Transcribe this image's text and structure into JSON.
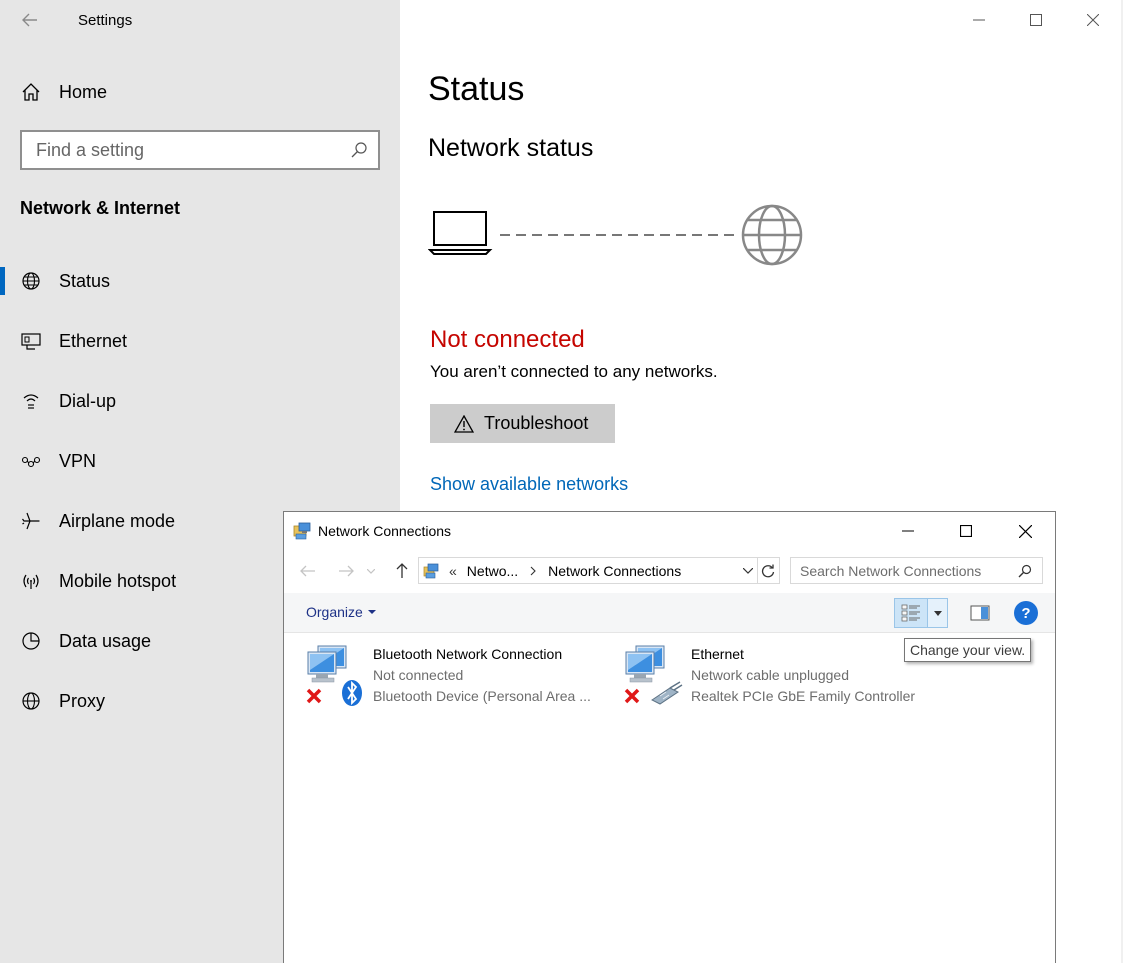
{
  "settings": {
    "app_title": "Settings",
    "home_label": "Home",
    "search_placeholder": "Find a setting",
    "section_title": "Network & Internet",
    "nav_items": [
      {
        "label": "Status",
        "icon": "status-globe-icon"
      },
      {
        "label": "Ethernet",
        "icon": "ethernet-icon"
      },
      {
        "label": "Dial-up",
        "icon": "dial-up-icon"
      },
      {
        "label": "VPN",
        "icon": "vpn-icon"
      },
      {
        "label": "Airplane mode",
        "icon": "airplane-icon"
      },
      {
        "label": "Mobile hotspot",
        "icon": "hotspot-icon"
      },
      {
        "label": "Data usage",
        "icon": "data-usage-icon"
      },
      {
        "label": "Proxy",
        "icon": "proxy-globe-icon"
      }
    ],
    "active_nav": "Status",
    "main": {
      "page_title": "Status",
      "sub_title": "Network status",
      "connection_state": "Not connected",
      "description": "You aren’t connected to any networks.",
      "troubleshoot_label": "Troubleshoot",
      "show_networks_link": "Show available networks"
    },
    "colors": {
      "accent": "#0067c0",
      "error": "#c50500",
      "link": "#0067b8",
      "sidebar_bg": "#e6e6e6"
    }
  },
  "network_connections": {
    "window_title": "Network Connections",
    "breadcrumb": {
      "prefix": "«",
      "parent": "Netwo...",
      "current": "Network Connections"
    },
    "search_placeholder": "Search Network Connections",
    "organize_label": "Organize",
    "tooltip": "Change your view.",
    "connections": [
      {
        "name": "Bluetooth Network Connection",
        "status": "Not connected",
        "device": "Bluetooth Device (Personal Area ...",
        "icon": "bluetooth-network-icon"
      },
      {
        "name": "Ethernet",
        "status": "Network cable unplugged",
        "device": "Realtek PCIe GbE Family Controller",
        "icon": "ethernet-network-icon"
      }
    ]
  }
}
